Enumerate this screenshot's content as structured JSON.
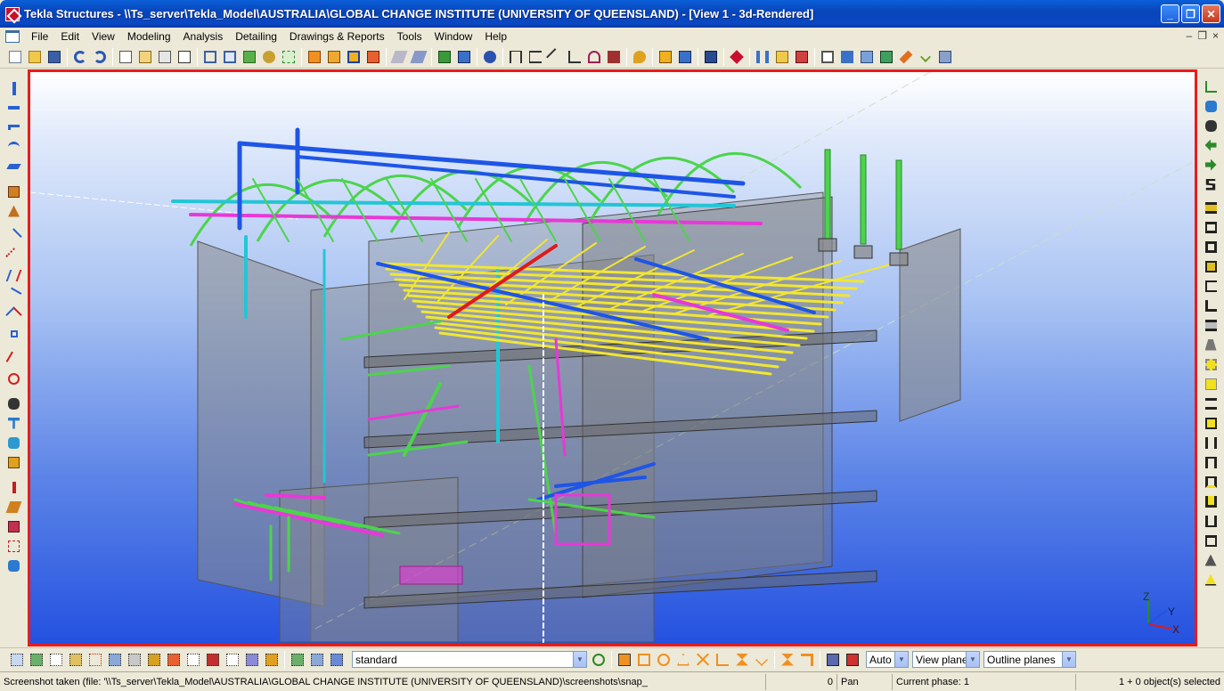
{
  "window": {
    "title": "Tekla Structures - \\\\Ts_server\\Tekla_Model\\AUSTRALIA\\GLOBAL CHANGE INSTITUTE (UNIVERSITY OF QUEENSLAND) - [View 1 - 3d-Rendered]",
    "minimize": "_",
    "maximize": "❐",
    "close": "✕"
  },
  "menu": {
    "items": [
      "File",
      "Edit",
      "View",
      "Modeling",
      "Analysis",
      "Detailing",
      "Drawings & Reports",
      "Tools",
      "Window",
      "Help"
    ],
    "mdi_minimize": "–",
    "mdi_restore": "❐",
    "mdi_close": "×"
  },
  "bottom_toolbar": {
    "view_filter": "standard",
    "snap_mode": "Auto",
    "plane": "View plane",
    "planes_display": "Outline planes"
  },
  "status": {
    "message": "Screenshot taken (file: '\\\\Ts_server\\Tekla_Model\\AUSTRALIA\\GLOBAL CHANGE INSTITUTE (UNIVERSITY OF QUEENSLAND)\\screenshots\\snap_",
    "count": "0",
    "mode": "Pan",
    "phase": "Current phase: 1",
    "selection": "1 + 0 object(s) selected"
  },
  "colors": {
    "title_bar": "#0a49c4",
    "viewport_border": "#e81c1c",
    "beam_green": "#4cd44c",
    "beam_blue": "#1e55e6",
    "beam_cyan": "#22c6d6",
    "beam_yellow": "#f2e632",
    "beam_magenta": "#e838d8",
    "beam_red": "#e01a1a",
    "panel_gray": "#8a8a8a"
  }
}
